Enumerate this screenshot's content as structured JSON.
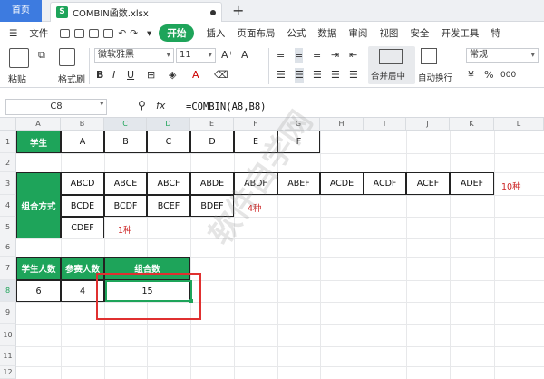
{
  "tabs": {
    "home": "首页",
    "file": "COMBIN函数.xlsx",
    "file_icon": "S"
  },
  "menu": {
    "file": "文件",
    "start": "开始",
    "items": [
      "插入",
      "页面布局",
      "公式",
      "数据",
      "审阅",
      "视图",
      "安全",
      "开发工具",
      "特"
    ]
  },
  "ribbon": {
    "paste": "粘贴",
    "format_painter": "格式刷",
    "font_name": "微软雅黑",
    "font_size": "11",
    "bold": "B",
    "italic": "I",
    "underline": "U",
    "merge": "合并居中",
    "wrap": "自动换行",
    "number_format": "常规",
    "currency": "¥",
    "percent": "%",
    "thousands": "000"
  },
  "formula_bar": {
    "name_box": "C8",
    "fx": "fx",
    "formula": "=COMBIN(A8,B8)"
  },
  "columns": [
    "A",
    "B",
    "C",
    "D",
    "E",
    "F",
    "G",
    "H",
    "I",
    "J",
    "K",
    "L"
  ],
  "rows": [
    "1",
    "2",
    "3",
    "4",
    "5",
    "6",
    "7",
    "8",
    "9",
    "10",
    "11",
    "12"
  ],
  "sheet": {
    "r1": {
      "label": "学生",
      "values": [
        "A",
        "B",
        "C",
        "D",
        "E",
        "F"
      ]
    },
    "r3": {
      "label": "组合方式",
      "values": [
        "ABCD",
        "ABCE",
        "ABCF",
        "ABDE",
        "ABDF",
        "ABEF",
        "ACDE",
        "ACDF",
        "ACEF",
        "ADEF"
      ],
      "note": "10种"
    },
    "r4": {
      "values": [
        "BCDE",
        "BCDF",
        "BCEF",
        "BDEF"
      ],
      "note": "4种"
    },
    "r5": {
      "values": [
        "CDEF"
      ],
      "note": "1种"
    },
    "r7": {
      "headers": [
        "学生人数",
        "参赛人数",
        "组合数"
      ]
    },
    "r8": {
      "values": [
        "6",
        "4",
        "15"
      ]
    }
  },
  "watermark": "软件自学网",
  "colors": {
    "accent": "#1ea45a",
    "home_tab": "#3d7be0",
    "note": "#cc2222",
    "highlight": "#e03030"
  }
}
